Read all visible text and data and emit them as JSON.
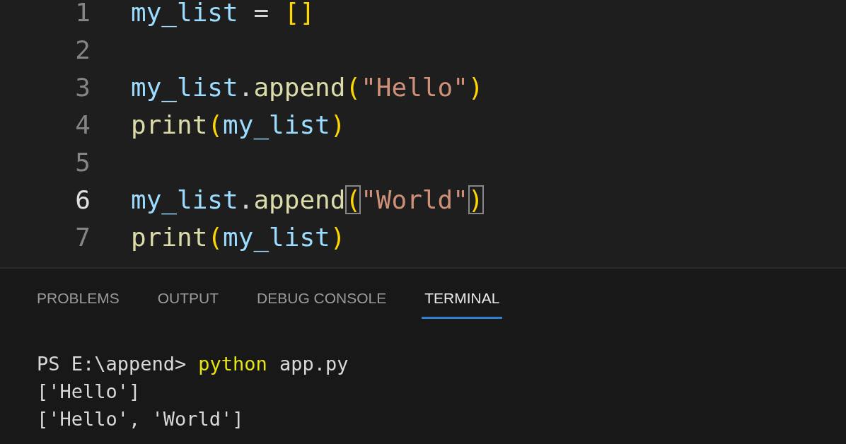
{
  "editor": {
    "lines": [
      {
        "number": "1",
        "current": false,
        "tokens": [
          {
            "kind": "variable",
            "text": "my_list"
          },
          {
            "kind": "plain",
            "text": " = "
          },
          {
            "kind": "bracket",
            "text": "[]"
          }
        ]
      },
      {
        "number": "2",
        "current": false
      },
      {
        "number": "3",
        "current": false,
        "tokens": [
          {
            "kind": "variable",
            "text": "my_list"
          },
          {
            "kind": "plain",
            "text": "."
          },
          {
            "kind": "function",
            "text": "append"
          },
          {
            "kind": "bracket",
            "text": "("
          },
          {
            "kind": "string",
            "text": "\"Hello\""
          },
          {
            "kind": "bracket",
            "text": ")"
          }
        ]
      },
      {
        "number": "4",
        "current": false,
        "tokens": [
          {
            "kind": "function",
            "text": "print"
          },
          {
            "kind": "bracket",
            "text": "("
          },
          {
            "kind": "variable",
            "text": "my_list"
          },
          {
            "kind": "bracket",
            "text": ")"
          }
        ]
      },
      {
        "number": "5",
        "current": false
      },
      {
        "number": "6",
        "current": true,
        "tokens": [
          {
            "kind": "variable",
            "text": "my_list"
          },
          {
            "kind": "plain",
            "text": "."
          },
          {
            "kind": "function",
            "text": "append"
          },
          {
            "kind": "bracket",
            "text": "(",
            "matched": true
          },
          {
            "kind": "string",
            "text": "\"World\""
          },
          {
            "kind": "bracket",
            "text": ")",
            "matched": true
          }
        ]
      },
      {
        "number": "7",
        "current": false,
        "tokens": [
          {
            "kind": "function",
            "text": "print"
          },
          {
            "kind": "bracket",
            "text": "("
          },
          {
            "kind": "variable",
            "text": "my_list"
          },
          {
            "kind": "bracket",
            "text": ")"
          }
        ]
      }
    ]
  },
  "panel": {
    "tabs": [
      {
        "label": "PROBLEMS",
        "selected": false
      },
      {
        "label": "OUTPUT",
        "selected": false
      },
      {
        "label": "DEBUG CONSOLE",
        "selected": false
      },
      {
        "label": "TERMINAL",
        "selected": true
      }
    ],
    "terminal": [
      {
        "kind": "command",
        "prompt": "PS E:\\append>",
        "command": "python",
        "args": "app.py"
      },
      {
        "kind": "output",
        "text": "['Hello']"
      },
      {
        "kind": "output",
        "text": "['Hello', 'World']"
      }
    ]
  }
}
